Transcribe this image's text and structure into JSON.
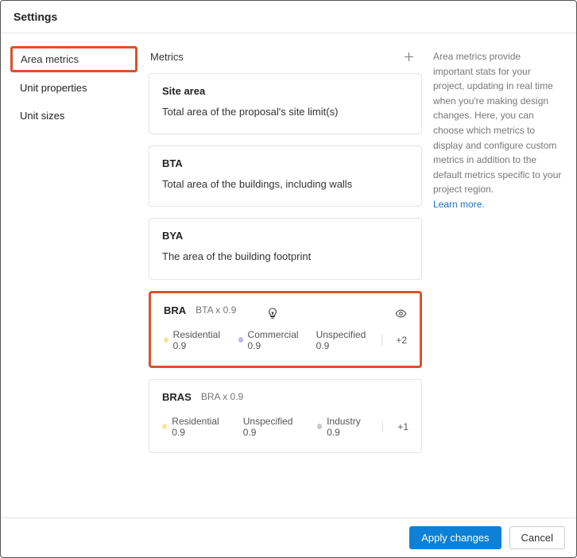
{
  "title": "Settings",
  "sidebar": {
    "items": [
      {
        "label": "Area metrics",
        "active": true
      },
      {
        "label": "Unit properties",
        "active": false
      },
      {
        "label": "Unit sizes",
        "active": false
      }
    ]
  },
  "metrics_header": "Metrics",
  "metrics": [
    {
      "title": "Site area",
      "subtitle": "",
      "desc": "Total area of the proposal's site limit(s)",
      "tags": [],
      "more": "",
      "eye": false,
      "highlighted": false
    },
    {
      "title": "BTA",
      "subtitle": "",
      "desc": "Total area of the buildings, including walls",
      "tags": [],
      "more": "",
      "eye": false,
      "highlighted": false
    },
    {
      "title": "BYA",
      "subtitle": "",
      "desc": "The area of the building footprint",
      "tags": [],
      "more": "",
      "eye": false,
      "highlighted": false
    },
    {
      "title": "BRA",
      "subtitle": "BTA x 0.9",
      "desc": "",
      "tags": [
        {
          "color": "yellow",
          "label": "Residential 0.9"
        },
        {
          "color": "purple",
          "label": "Commercial 0.9"
        },
        {
          "color": "",
          "label": "Unspecified 0.9"
        }
      ],
      "more": "+2",
      "eye": true,
      "cursor": true,
      "highlighted": true
    },
    {
      "title": "BRAS",
      "subtitle": "BRA x 0.9",
      "desc": "",
      "tags": [
        {
          "color": "yellow",
          "label": "Residential 0.9"
        },
        {
          "color": "",
          "label": "Unspecified 0.9"
        },
        {
          "color": "grey",
          "label": "Industry 0.9"
        }
      ],
      "more": "+1",
      "eye": false,
      "highlighted": false
    }
  ],
  "help": {
    "text": "Area metrics provide important stats for your project, updating in real time when you're making design changes. Here, you can choose which metrics to display and configure custom metrics in addition to the default metrics specific to your project region.",
    "link": "Learn more"
  },
  "footer": {
    "apply": "Apply changes",
    "cancel": "Cancel"
  }
}
